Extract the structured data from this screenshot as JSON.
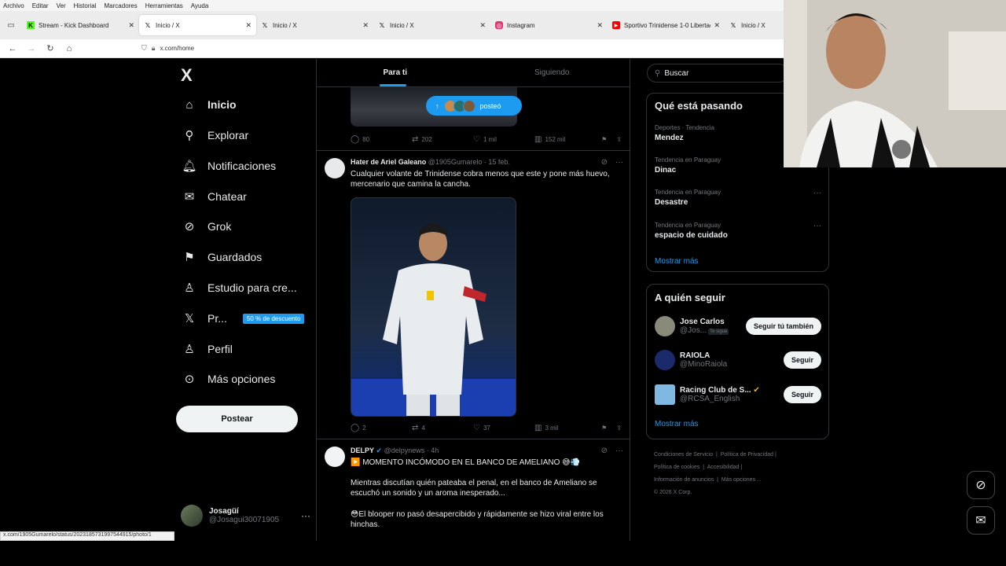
{
  "browser": {
    "menu": [
      "Archivo",
      "Editar",
      "Ver",
      "Historial",
      "Marcadores",
      "Herramientas",
      "Ayuda"
    ],
    "tabs": [
      {
        "title": "Stream - Kick Dashboard",
        "icon": "kick-icon",
        "color": "#53fc18"
      },
      {
        "title": "Inicio / X",
        "icon": "x-icon",
        "color": "#000000"
      },
      {
        "title": "Inicio / X",
        "icon": "x-icon",
        "color": "#000000"
      },
      {
        "title": "Inicio / X",
        "icon": "x-icon",
        "color": "#000000"
      },
      {
        "title": "Instagram",
        "icon": "instagram-icon",
        "color": "#e1306c"
      },
      {
        "title": "Sportivo Trinidense 1-0 Libertad",
        "icon": "youtube-icon",
        "color": "#ff0000"
      },
      {
        "title": "Inicio / X",
        "icon": "x-icon",
        "color": "#000000"
      }
    ],
    "url": "x.com/home",
    "status_url": "x.com/1905Gumarelo/status/2023185731997544915/photo/1"
  },
  "nav": {
    "logo": "X",
    "items": [
      {
        "label": "Inicio",
        "icon": "home-icon"
      },
      {
        "label": "Explorar",
        "icon": "search-icon"
      },
      {
        "label": "Notificaciones",
        "icon": "bell-icon"
      },
      {
        "label": "Chatear",
        "icon": "mail-icon"
      },
      {
        "label": "Grok",
        "icon": "grok-icon"
      },
      {
        "label": "Guardados",
        "icon": "bookmark-icon"
      },
      {
        "label": "Estudio para cre...",
        "icon": "creator-studio-icon"
      },
      {
        "label": "Pr...",
        "icon": "x-premium-icon"
      },
      {
        "label": "Perfil",
        "icon": "person-icon"
      },
      {
        "label": "Más opciones",
        "icon": "more-circle-icon"
      }
    ],
    "premium_badge": "50 % de descuento",
    "post_button": "Postear",
    "account": {
      "name": "Josagüí",
      "handle": "@Josagui30071905"
    }
  },
  "timeline": {
    "tabs": [
      "Para ti",
      "Siguiendo"
    ],
    "posted_pill": "posteó",
    "first_post_stats": {
      "replies": "80",
      "reposts": "202",
      "likes": "1 mil",
      "views": "152 mil"
    },
    "tweets": [
      {
        "name": "Hater de Ariel Galeano",
        "handle": "@1905Gumarelo",
        "time": "15 feb.",
        "text": "Cualquier volante de Trinidense cobra menos que este y pone más huevo, mercenario que camina la cancha.",
        "stats": {
          "replies": "2",
          "reposts": "4",
          "likes": "37",
          "views": "3 mil"
        }
      },
      {
        "name": "DELPY",
        "handle": "@delpynews",
        "time": "4h",
        "text": "▶️ MOMENTO INCÓMODO EN EL BANCO DE AMELIANO 😅💨",
        "text2": "Mientras discutían quién pateaba el penal, en el banco de Ameliano se escuchó un sonido y un aroma inesperado...",
        "text3": "😳El blooper no pasó desapercibido y rápidamente se hizo viral entre los hinchas."
      }
    ]
  },
  "right": {
    "search_placeholder": "Buscar",
    "trends_title": "Qué está pasando",
    "trends": [
      {
        "meta": "Deportes · Tendencia",
        "title": "Mendez"
      },
      {
        "meta": "Tendencia en Paraguay",
        "title": "Dinac"
      },
      {
        "meta": "Tendencia en Paraguay",
        "title": "Desastre"
      },
      {
        "meta": "Tendencia en Paraguay",
        "title": "espacio de cuidado"
      }
    ],
    "show_more": "Mostrar más",
    "follow_title": "A quién seguir",
    "follow": [
      {
        "name": "Jose Carlos",
        "handle": "@Jos...",
        "tag": "Te sigue",
        "button": "Seguir tú también"
      },
      {
        "name": "RAIOLA",
        "handle": "@MinoRaiola",
        "button": "Seguir"
      },
      {
        "name": "Racing Club de S...",
        "handle": "@RCSA_English",
        "button": "Seguir"
      }
    ],
    "footer": [
      "Condiciones de Servicio",
      "Política de Privacidad",
      "Política de cookies",
      "Accesibilidad",
      "Información de anuncios",
      "Más opciones ...",
      "© 2026 X Corp."
    ]
  },
  "colors": {
    "accent": "#1d9bf0",
    "background": "#000000",
    "border": "#2f3336",
    "muted": "#71767b"
  }
}
